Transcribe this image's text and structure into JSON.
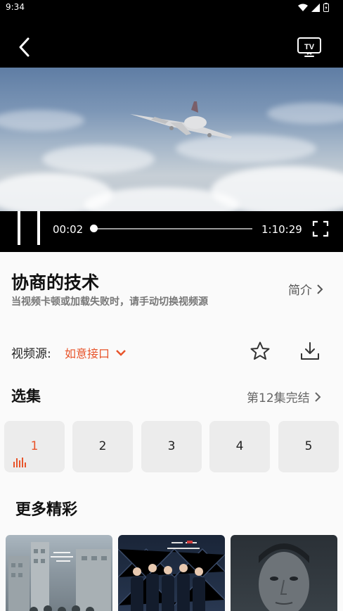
{
  "status_bar": {
    "time": "9:34"
  },
  "player": {
    "current_time": "00:02",
    "total_time": "1:10:29",
    "progress": 0.0005
  },
  "info": {
    "title": "协商的技术",
    "intro_label": "简介",
    "notice": "当视频卡顿或加载失败时，请手动切换视频源"
  },
  "source": {
    "label": "视频源:",
    "value": "如意接口"
  },
  "episodes": {
    "title": "选集",
    "status": "第12集完结",
    "items": [
      "1",
      "2",
      "3",
      "4",
      "5"
    ],
    "active_index": 0
  },
  "more": {
    "title": "更多精彩"
  },
  "colors": {
    "accent": "#e8542a",
    "tile_bg": "#ececec"
  }
}
